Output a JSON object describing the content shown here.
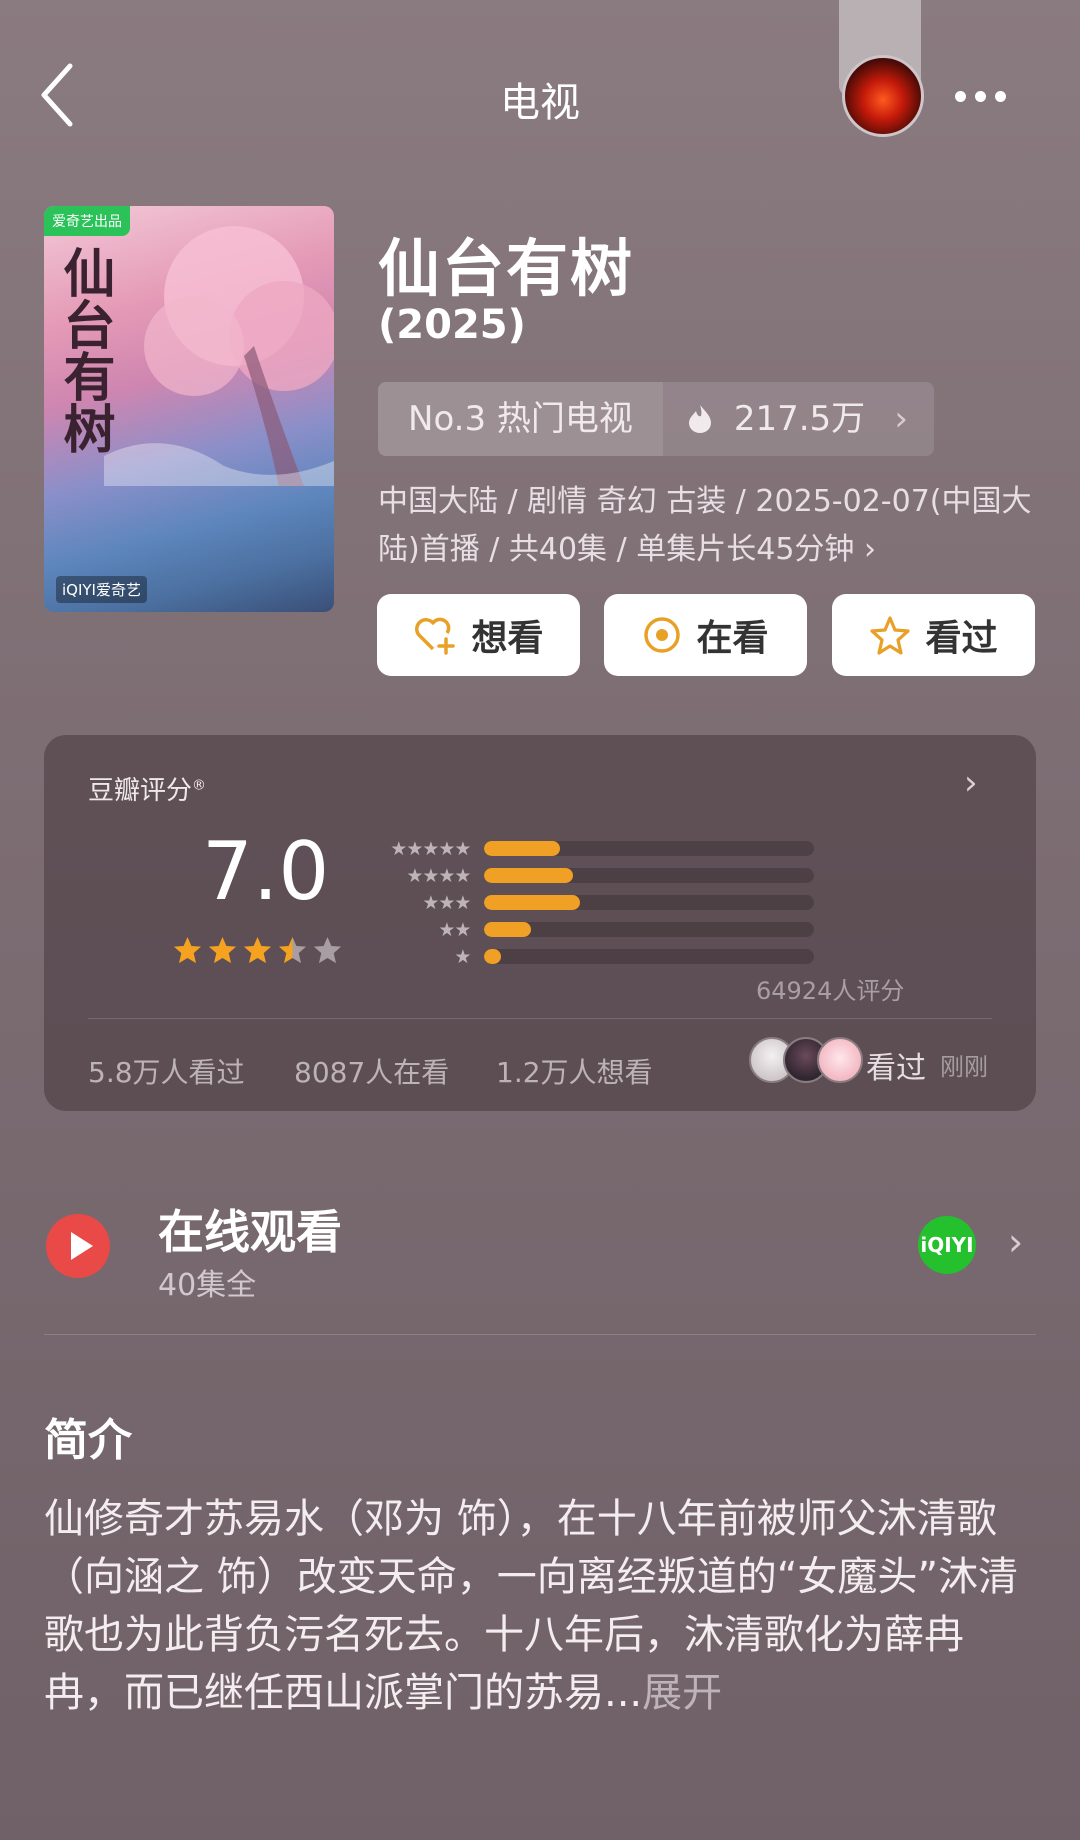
{
  "header": {
    "title": "电视",
    "icons": [
      "back-arrow-icon",
      "more-icon"
    ]
  },
  "poster": {
    "badge": "爱奇艺出品",
    "title_art": "仙台有树",
    "brand": "iQIYI爱奇艺"
  },
  "show": {
    "title": "仙台有树",
    "year": "(2025)",
    "rank": "No.3 热门电视",
    "heat": "217.5万",
    "meta": "中国大陆 / 剧情 奇幻 古装 / 2025-02-07(中国大陆)首播 / 共40集 / 单集片长45分钟 ›"
  },
  "actions": {
    "want": "想看",
    "watching": "在看",
    "watched": "看过"
  },
  "rating": {
    "label": "豆瓣评分",
    "mark": "®",
    "score": "7.0",
    "stars_value": 3.5,
    "distribution": [
      {
        "stars": "★★★★★",
        "fraction": 0.23
      },
      {
        "stars": "★★★★",
        "fraction": 0.27
      },
      {
        "stars": "★★★",
        "fraction": 0.29
      },
      {
        "stars": "★★",
        "fraction": 0.14
      },
      {
        "stars": "★",
        "fraction": 0.05
      }
    ],
    "count": "64924人评分",
    "seen": "5.8万人看过",
    "watching": "8087人在看",
    "want": "1.2万人想看",
    "friend_action": "看过",
    "friend_time": "刚刚",
    "bar_color": "#f0a024"
  },
  "online": {
    "title": "在线观看",
    "subtitle": "40集全",
    "provider": "iQIYI",
    "provider_color": "#25c02d"
  },
  "intro": {
    "heading": "简介",
    "text": "仙修奇才苏易水（邓为 饰），在十八年前被师父沐清歌（向涵之 饰）改变天命，一向离经叛道的“女魔头”沐清歌也为此背负污名死去。十八年后，沐清歌化为薛冉冉，而已继任西山派掌门的苏易...",
    "more": "展开"
  }
}
